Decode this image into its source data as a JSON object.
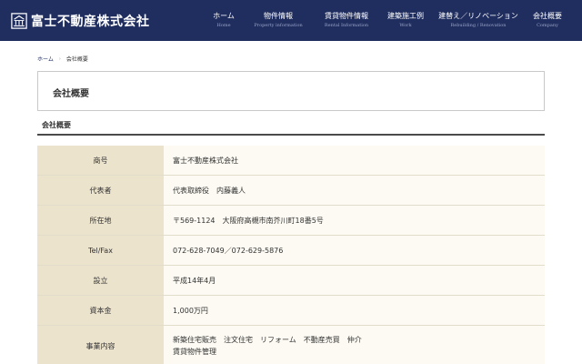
{
  "header": {
    "company_name": "富士不動産株式会社",
    "nav": [
      {
        "label": "ホーム",
        "sub": "Home"
      },
      {
        "label": "物件情報",
        "sub": "Property information"
      },
      {
        "label": "賃貸物件情報",
        "sub": "Rental Information"
      },
      {
        "label": "建築施工例",
        "sub": "Work"
      },
      {
        "label": "建替え／リノベーション",
        "sub": "Rebuilding / Renovation"
      },
      {
        "label": "会社概要",
        "sub": "Company"
      }
    ]
  },
  "breadcrumb": {
    "home": "ホーム",
    "current": "会社概要"
  },
  "page_title": "会社概要",
  "section_title": "会社概要",
  "company_table": [
    {
      "label": "商号",
      "values": [
        "富士不動産株式会社"
      ]
    },
    {
      "label": "代表者",
      "values": [
        "代表取締役　内藤義人"
      ]
    },
    {
      "label": "所在地",
      "values": [
        "〒569-1124　大阪府高槻市南芥川町18番5号"
      ]
    },
    {
      "label": "Tel/Fax",
      "values": [
        "072-628-7049／072-629-5876"
      ]
    },
    {
      "label": "設立",
      "values": [
        "平成14年4月"
      ]
    },
    {
      "label": "資本金",
      "values": [
        "1,000万円"
      ]
    },
    {
      "label": "事業内容",
      "values": [
        "新築住宅販売　注文住宅　リフォーム　不動産売買　仲介",
        "賃貸物件管理"
      ]
    }
  ],
  "colors": {
    "header_bg": "#1f2d5f",
    "label_bg": "#ece3cd",
    "value_bg": "#fcfaf2"
  }
}
